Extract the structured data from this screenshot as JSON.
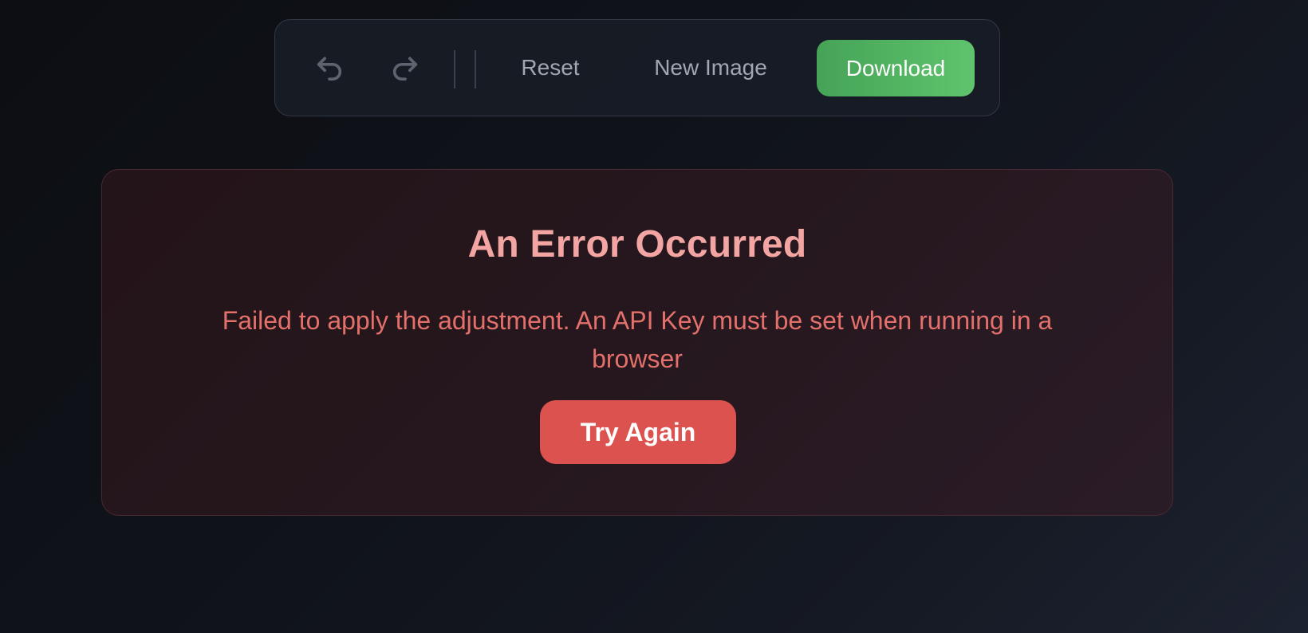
{
  "toolbar": {
    "undo_icon": "undo-icon",
    "redo_icon": "redo-icon",
    "reset_label": "Reset",
    "new_image_label": "New Image",
    "download_label": "Download",
    "download_color": "#4cae5c"
  },
  "error": {
    "title": "An Error Occurred",
    "message": "Failed to apply the adjustment. An API Key must be set when running in a browser",
    "retry_label": "Try Again",
    "accent_color": "#db524f"
  }
}
